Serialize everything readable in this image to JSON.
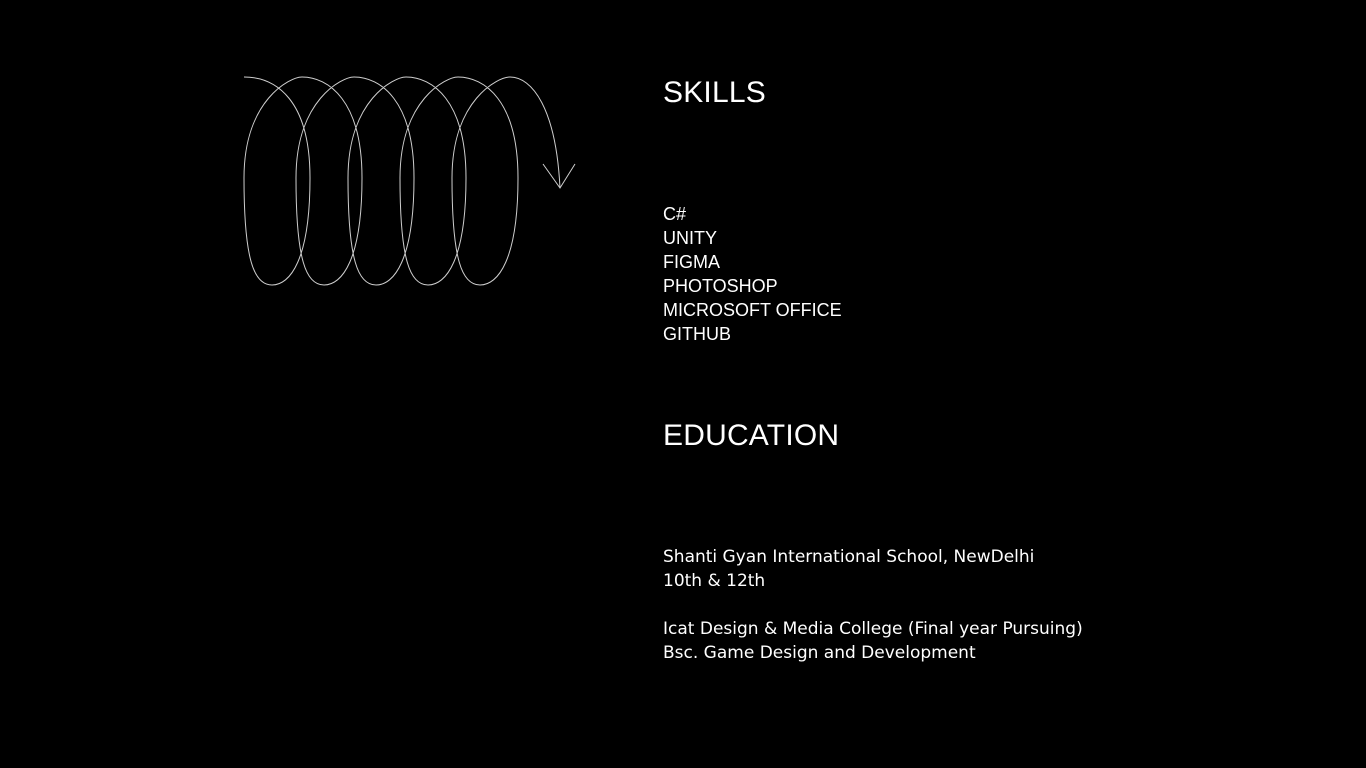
{
  "colors": {
    "background": "#000000",
    "text": "#ffffff",
    "decoration_stroke": "#cfcfcf"
  },
  "decoration": {
    "icon": "spiral-arrow-icon"
  },
  "skills": {
    "title": "SKILLS",
    "items": [
      "C#",
      "UNITY",
      "FIGMA",
      "PHOTOSHOP",
      "MICROSOFT OFFICE",
      "GITHUB"
    ]
  },
  "education": {
    "title": "EDUCATION",
    "entries": [
      {
        "institution": "Shanti Gyan International School, NewDelhi",
        "detail": "10th & 12th"
      },
      {
        "institution": "Icat Design & Media College (Final year Pursuing)",
        "detail": "Bsc. Game Design and Development"
      }
    ]
  }
}
